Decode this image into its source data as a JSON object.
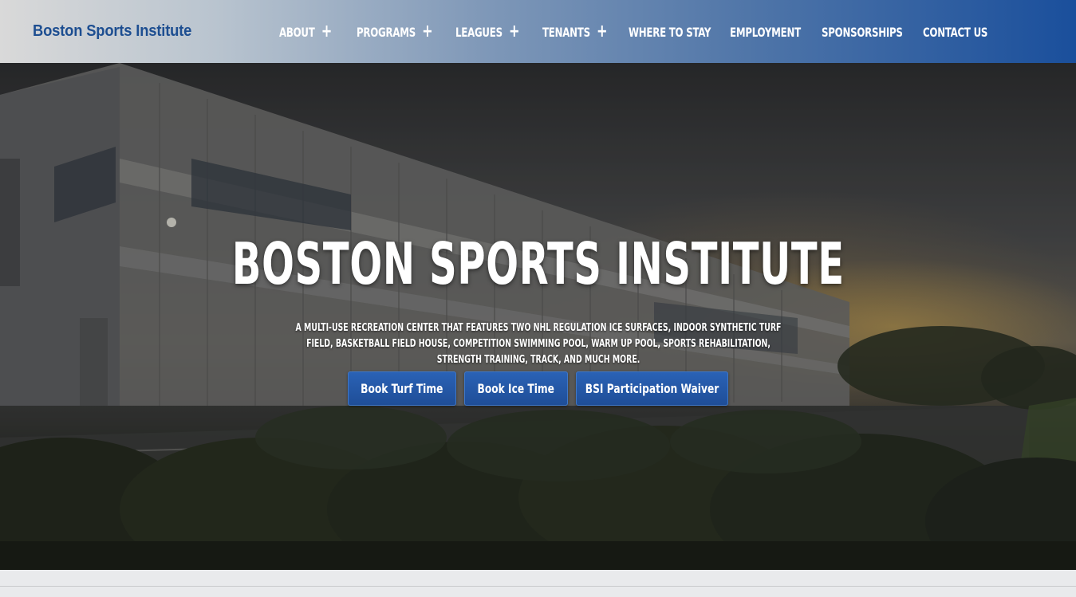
{
  "header": {
    "logo_text": "Boston Sports Institute",
    "nav": [
      {
        "label": "ABOUT",
        "has_submenu": true
      },
      {
        "label": "PROGRAMS",
        "has_submenu": true
      },
      {
        "label": "LEAGUES",
        "has_submenu": true
      },
      {
        "label": "TENANTS",
        "has_submenu": true
      },
      {
        "label": "WHERE TO STAY",
        "has_submenu": false
      },
      {
        "label": "EMPLOYMENT",
        "has_submenu": false
      },
      {
        "label": "SPONSORSHIPS",
        "has_submenu": false
      },
      {
        "label": "CONTACT US",
        "has_submenu": false
      }
    ],
    "submenu_glyph": "+"
  },
  "hero": {
    "title": "BOSTON SPORTS INSTITUTE",
    "subtitle": "A MULTI-USE RECREATION CENTER THAT FEATURES TWO NHL REGULATION ICE SURFACES, INDOOR SYNTHETIC TURF FIELD, BASKETBALL FIELD HOUSE, COMPETITION SWIMMING POOL, WARM UP POOL, SPORTS REHABILITATION, STRENGTH TRAINING, TRACK, AND MUCH MORE.",
    "buttons": [
      {
        "label": "Book Turf Time"
      },
      {
        "label": "Book Ice Time"
      },
      {
        "label": "BSI Participation Waiver"
      }
    ]
  },
  "colors": {
    "brand_blue": "#1d4e91",
    "button_blue": "#2a62b5",
    "header_gradient_end": "#1a4f9c"
  }
}
